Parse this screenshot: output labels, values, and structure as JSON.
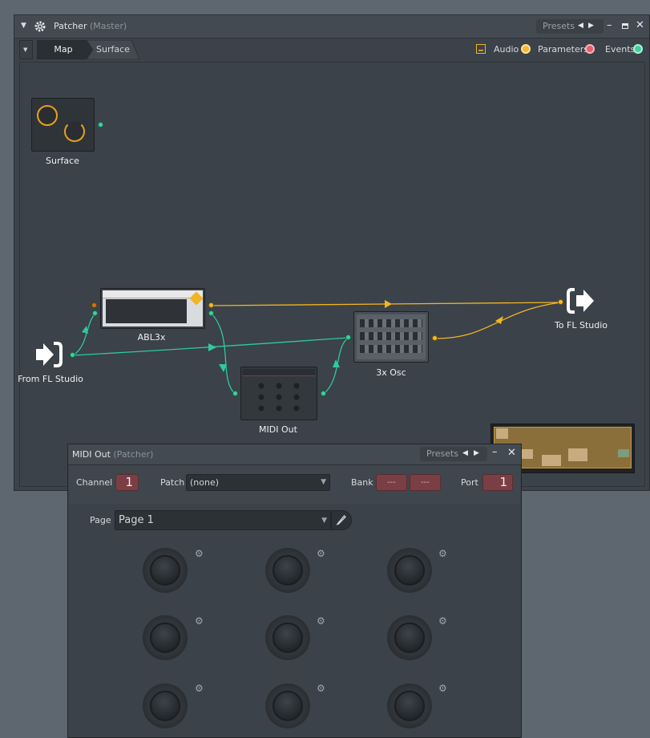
{
  "patcher": {
    "title": "Patcher",
    "subtitle": "(Master)",
    "presets_label": "Presets",
    "tabs": [
      {
        "label": "Map",
        "active": true
      },
      {
        "label": "Surface",
        "active": false
      }
    ],
    "legend": [
      {
        "label": "Audio",
        "color": "#f5b82e"
      },
      {
        "label": "Parameters",
        "color": "#e8606a"
      },
      {
        "label": "Events",
        "color": "#3fd19c"
      }
    ],
    "nodes": {
      "surface": "Surface",
      "abl3x": "ABL3x",
      "osc3x": "3x Osc",
      "midi_out": "MIDI Out",
      "to_fl": "To FL Studio",
      "from_fl": "From FL Studio"
    },
    "colors": {
      "audio_wire": "#f2b61f",
      "event_wire": "#30c9a0"
    }
  },
  "midi_out": {
    "title": "MIDI Out",
    "subtitle": "(Patcher)",
    "presets_label": "Presets",
    "channel_label": "Channel",
    "channel_value": "1",
    "patch_label": "Patch",
    "patch_value": "(none)",
    "bank_label": "Bank",
    "bank_value_1": "---",
    "bank_value_2": "---",
    "port_label": "Port",
    "port_value": "1",
    "page_label": "Page",
    "page_value": "Page 1"
  }
}
